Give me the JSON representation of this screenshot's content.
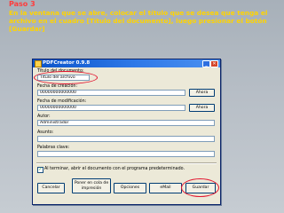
{
  "slide": {
    "step": "Paso 3",
    "instruction": "En la ventana que se abre, colocar el título que se desea que tenga el archivo en el cuadro [Título del documento], luego presionar el botón [Guardar]"
  },
  "dialog": {
    "title": "PDFCreator 0.9.8",
    "fields": {
      "doc_title_label": "Título del documento:",
      "doc_title_value": "Título del archivo",
      "created_label": "Fecha de creación:",
      "created_value": "00000000000000",
      "modified_label": "Fecha de modificación:",
      "modified_value": "00000000000000",
      "author_label": "Autor:",
      "author_value": "Administrador",
      "subject_label": "Asunto:",
      "subject_value": "",
      "keywords_label": "Palabras clave:",
      "keywords_value": ""
    },
    "buttons": {
      "now_1": "Ahora",
      "now_2": "Ahora",
      "cancel": "Cancelar",
      "queue": "Poner en cola de impresión",
      "options": "Opciones",
      "email": "eMail",
      "save": "Guardar"
    },
    "checkbox_label": "Al terminar, abrir el documento con el programa predeterminado.",
    "checkbox_checked": true
  },
  "colors": {
    "step": "#ff3b3b",
    "instruction": "#ffd400",
    "highlight_circle": "#e2122d",
    "titlebar": "#0a53c8"
  },
  "icons": {
    "app": "pdfcreator-icon",
    "minimize": "minimize-icon",
    "close": "close-icon",
    "check": "checkmark-icon"
  }
}
